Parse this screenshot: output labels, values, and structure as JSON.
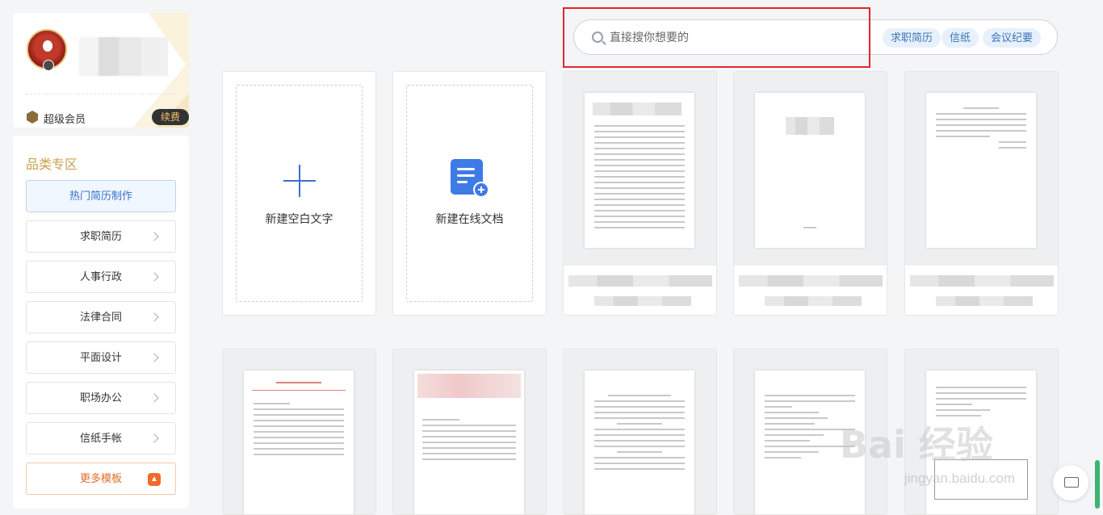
{
  "profile": {
    "vip_label": "超级会员",
    "renew_label": "续费"
  },
  "categories": {
    "title": "品类专区",
    "items": [
      {
        "label": "热门简历制作"
      },
      {
        "label": "求职简历"
      },
      {
        "label": "人事行政"
      },
      {
        "label": "法律合同"
      },
      {
        "label": "平面设计"
      },
      {
        "label": "职场办公"
      },
      {
        "label": "信纸手帐"
      },
      {
        "label": "更多模板"
      }
    ]
  },
  "search": {
    "placeholder": "直接搜你想要的",
    "tags": [
      "求职简历",
      "信纸",
      "会议纪要"
    ]
  },
  "create": {
    "blank_label": "新建空白文字",
    "online_label": "新建在线文档"
  },
  "colors": {
    "accent": "#3b6fcf",
    "highlight_border": "#e3262b",
    "vip_gold": "#c8a24a"
  },
  "watermark": {
    "brand": "Bai 经验",
    "url": "jingyan.baidu.com"
  }
}
